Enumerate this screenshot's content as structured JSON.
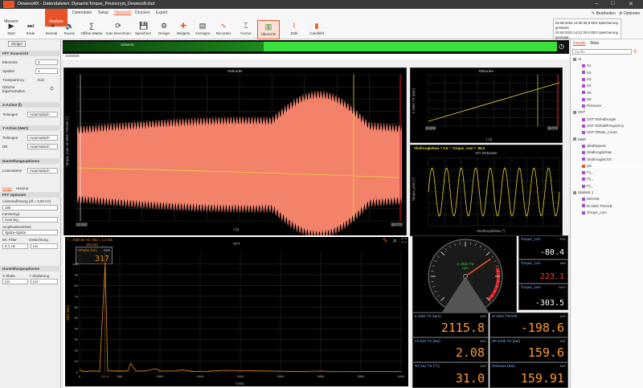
{
  "app": {
    "title": "DewesoftX - Datendateien: DynamicTorque_Piezocryst_Dewesoft.dxd"
  },
  "window_controls": {
    "minimize": "–",
    "maximize": "□",
    "close": "✕"
  },
  "ribbon": {
    "main_tabs": [
      {
        "label": "Messen"
      },
      {
        "label": "Analyse"
      }
    ],
    "sub_tabs": [
      {
        "label": "Datendatei"
      },
      {
        "label": "Setup"
      },
      {
        "label": "Übersicht"
      },
      {
        "label": "Drucken"
      },
      {
        "label": "Export"
      }
    ],
    "buttons": [
      {
        "label": "Start"
      },
      {
        "label": "Ende"
      },
      {
        "label": "Normal"
      },
      {
        "label": "Sound"
      },
      {
        "label": "Offline-Mathe"
      },
      {
        "label": "Auto berechnen"
      },
      {
        "label": "Speichern"
      },
      {
        "label": "Design"
      },
      {
        "label": "Widgets"
      },
      {
        "label": "Anzeigen"
      },
      {
        "label": "Recorder"
      },
      {
        "label": "Cursor"
      },
      {
        "label": "Übersicht"
      },
      {
        "label": "Zähl"
      },
      {
        "label": "Candlebl"
      }
    ],
    "right_links": {
      "edit": "Bearbeiten",
      "options": "Optionen"
    },
    "status_lines": [
      "02.08.2023 14:30:39,8 DE3 Speicherung gestartet.",
      "02.08.2023 14:31:29,0 DE3 Speicherung gestoppt."
    ]
  },
  "left_panel": {
    "widget_btn": "Widget",
    "fft_section": "FFT Voransicht",
    "rows": [
      {
        "label": "Elemente",
        "value": "1"
      },
      {
        "label": "Spalten",
        "value": "1"
      },
      {
        "label": "Transparency",
        "value": "AUS"
      }
    ],
    "same_props": "Gleiche Eigenschaften",
    "x_axis_section": "X-Achse (f)",
    "x_scale_label": "Teilungen",
    "x_scale_value": "Automatisch",
    "y_axis_section": "Y-Achse (Wert)",
    "y_scale_label": "Teilungen",
    "y_scale_value": "Automatisch",
    "y_db_label": "DB",
    "y_db_value": "Automatisch",
    "display_section": "Darstellungsoptionen",
    "linewidth_label": "Linienstärke",
    "linewidth_value": "Automatisch",
    "tabs": [
      "Setup",
      "Historie"
    ],
    "fft_options": "FFT Optionen",
    "resolution_label": "Linienauflösung (df = 3,09 Hz)",
    "resolution_value": "16k",
    "window_label": "Fenstertyp",
    "window_value": "Hanning",
    "amp_label": "Amplitudeneinheit",
    "amp_value": "Spitze-Spitze",
    "dc_label": "DC Filter",
    "dc_value": "0.1 Hz",
    "avg_label": "Gewichtung",
    "avg_value": "Lin",
    "disp_opts": "Darstellungsoptionen",
    "xscale_label": "X Skala",
    "xscale_value": "Lin",
    "yscale_label": "Y Skalierung",
    "yscale_value": "Lin"
  },
  "timeline": {
    "cursor_label": "10000:00",
    "range_label": "00:00:21 - 50.0000 s"
  },
  "recorder_main": {
    "title": "Rekorder",
    "ylabel": "Torque_com, M 1502 TS/AVE (°)",
    "xlabel": "t (s)",
    "x_start": "13,002",
    "x_end": "48,773"
  },
  "recorder_small": {
    "title": "Rekorder",
    "ylabel": "e 1502 TS (rpm)",
    "xlabel": "t (s)",
    "x_start": "13,002",
    "x_end": "48,773"
  },
  "xy_plot": {
    "title": "X/Y Rekorder",
    "header": "ShaftAngleRaw = 9,9 °; Torque_com = -88,9",
    "ylabel": "Torque_com (°)",
    "xlabel": "ShaftAngleRaw (°)"
  },
  "fft": {
    "title": "FFT",
    "header": "f = 4559,84 Hz; 80p = 1,2 Nm",
    "peak_label": "183 Nm",
    "peak_unit": "AVE",
    "peak_name": "RPM/m (Hz)",
    "peak_value": "317",
    "ylabel": "M/D (Nm)",
    "xlabel": "f (Hz)",
    "marker_freq": "317,6",
    "chart_data": {
      "type": "line",
      "xlim": [
        0,
        4000
      ],
      "ylim": [
        0,
        110
      ],
      "x": [
        0,
        50,
        100,
        150,
        200,
        250,
        317.6,
        350,
        400,
        500,
        600,
        635,
        700,
        800,
        953,
        1000,
        1200,
        1270,
        1400,
        1600,
        1800,
        2000,
        2200,
        2400,
        2600,
        2800,
        3000,
        3200,
        3400,
        3600,
        3800,
        4000
      ],
      "values": [
        2,
        0.5,
        0.5,
        1,
        0.8,
        0.6,
        101,
        1.2,
        0.8,
        1,
        0.8,
        8,
        1,
        0.8,
        3,
        0.8,
        0.8,
        2,
        0.5,
        0.6,
        1.5,
        1.2,
        1,
        0.8,
        0.5,
        0.5,
        0.8,
        0.4,
        0.3,
        0.3,
        0.3,
        0.3
      ],
      "y_ticks": [
        "0",
        "10",
        "20",
        "30",
        "40",
        "50",
        "60",
        "70",
        "80",
        "90",
        "100"
      ],
      "x_ticks": [
        "0",
        "317,6",
        "500",
        "1000",
        "1500",
        "2000",
        "2500",
        "3000",
        "3500",
        "4000"
      ]
    }
  },
  "gauge": {
    "label": "e 1502 TS",
    "unit": "rpm",
    "value": 2115.8,
    "max": 3000
  },
  "tiles": [
    {
      "name": "Torque_com",
      "unit": "AVE",
      "value": "-80.4",
      "color": "#ffffff"
    },
    {
      "name": "Torque_com",
      "unit": "MIN",
      "value": "223.1",
      "color": "#ff3b3b"
    },
    {
      "name": "Torque_com",
      "unit": "MAX",
      "value": "-303.5",
      "color": "#ffffff"
    },
    {
      "name": "e 1502 TS (rpm)",
      "unit": "AVE",
      "value": "2115.8",
      "color": "#ff9a2a"
    },
    {
      "name": "M 1502 TS/AVE",
      "unit": "AVE",
      "value": "-198.6",
      "color": "#ff9a2a"
    },
    {
      "name": "LP 510 TS (bar)",
      "unit": "AVE",
      "value": "2.08",
      "color": "#ff9a2a"
    },
    {
      "name": "HP 513b TS (bar)",
      "unit": "AVE",
      "value": "159.6",
      "color": "#ff9a2a"
    },
    {
      "name": "NT 512 TS (°C)",
      "unit": "AVE",
      "value": "31.0",
      "color": "#ff9a2a"
    },
    {
      "name": "Pressure (bar)",
      "unit": "AVE",
      "value": "159.91",
      "color": "#ff9a2a"
    }
  ],
  "right_panel": {
    "tabs": [
      "Kanäle",
      "Slots"
    ],
    "search_placeholder": "Suche",
    "channels": [
      {
        "label": "AI",
        "color": "#888888"
      },
      {
        "label": "S1",
        "color": "#a44ecb"
      },
      {
        "label": "S2",
        "color": "#a44ecb"
      },
      {
        "label": "S3",
        "color": "#a44ecb"
      },
      {
        "label": "S4",
        "color": "#a44ecb"
      },
      {
        "label": "S5",
        "color": "#a44ecb"
      },
      {
        "label": "S6",
        "color": "#a44ecb"
      },
      {
        "label": "Pressure",
        "color": "#a44ecb"
      },
      {
        "label": "CNT",
        "color": "#888888"
      },
      {
        "label": "CNT 0/ShaftAngle",
        "color": "#a44ecb"
      },
      {
        "label": "CNT 0/ShaftFrequency",
        "color": "#a44ecb"
      },
      {
        "label": "CNT 0/Raw_Count",
        "color": "#a44ecb"
      },
      {
        "label": "Math",
        "color": "#888888"
      },
      {
        "label": "ShaftSpeed",
        "color": "#a44ecb"
      },
      {
        "label": "ShaftAngleRaw",
        "color": "#a44ecb"
      },
      {
        "label": "ShaftAngleCNT",
        "color": "#a44ecb"
      },
      {
        "label": "Mz",
        "color": "#e8542a"
      },
      {
        "label": "Fx_",
        "color": "#a44ecb"
      },
      {
        "label": "Fy_",
        "color": "#a44ecb"
      },
      {
        "label": "Fz_",
        "color": "#a44ecb"
      },
      {
        "label": "Statistik 1",
        "color": "#888888"
      },
      {
        "label": "Mz/AVE",
        "color": "#a44ecb"
      },
      {
        "label": "M 1502 TS/AVE",
        "color": "#a44ecb"
      },
      {
        "label": "Torque_com",
        "color": "#a44ecb"
      }
    ]
  },
  "colors": {
    "accent": "#e8542a",
    "signal": "#f3826b",
    "trace_yellow": "#e5d23a",
    "fft_trace": "#e08a1e"
  }
}
